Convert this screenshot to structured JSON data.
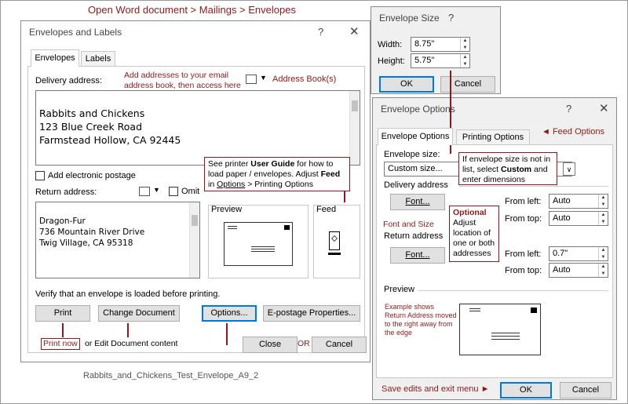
{
  "header_note": "Open Word document  > Mailings > Envelopes",
  "footer_caption": "Rabbits_and_Chickens_Test_Envelope_A9_2",
  "main_dialog": {
    "title": "Envelopes and Labels",
    "help": "?",
    "close": "✕",
    "tab_envelopes": "Envelopes",
    "tab_labels": "Labels",
    "delivery_label": "Delivery address:",
    "delivery_text": "Rabbits and Chickens\n123 Blue Creek Road\nFarmstead Hollow, CA 92445",
    "address_book_label": "Address Book(s)",
    "add_postage_label": "Add electronic postage",
    "return_label": "Return address:",
    "omit_label": "Omit",
    "return_text": "Dragon-Fur\n736 Mountain River Drive\nTwig Village, CA 95318",
    "preview_label": "Preview",
    "feed_label": "Feed",
    "verify_text": "Verify that an envelope is loaded before printing.",
    "print_btn": "Print",
    "change_doc_btn": "Change Document",
    "options_btn": "Options...",
    "epostage_btn": "E-postage Properties...",
    "close_btn": "Close",
    "cancel_btn": "Cancel"
  },
  "annotations": {
    "addresses_note": "Add addresses to your email address book, then access here",
    "printer_note_1": "See printer ",
    "printer_note_user_guide": "User Guide",
    "printer_note_2": " for how to load paper / envelopes.  Adjust ",
    "printer_note_feed": "Feed",
    "printer_note_3": " in ",
    "printer_note_options": "Options",
    "printer_note_4": " > Printing Options",
    "print_now_note": "Print now",
    "edit_doc_note": "or Edit Document content",
    "or_note": "OR",
    "feed_options_note": "Feed Options",
    "size_note_1": "If envelope size is not in list, select ",
    "size_note_custom": "Custom",
    "size_note_2": " and enter dimensions",
    "font_size_note": "Font and Size",
    "optional_note_title": "Optional",
    "optional_note_body": "Adjust location of one or both addresses",
    "example_note": "Example shows Return Address moved to the right away from the edge",
    "save_note": "Save edits and exit menu"
  },
  "size_dialog": {
    "title": "Envelope Size",
    "help": "?",
    "width_label": "Width:",
    "width_value": "8.75\"",
    "height_label": "Height:",
    "height_value": "5.75\"",
    "ok_btn": "OK",
    "cancel_btn": "Cancel"
  },
  "options_dialog": {
    "title": "Envelope Options",
    "help": "?",
    "close": "✕",
    "tab_envelope_options": "Envelope Options",
    "tab_printing_options": "Printing Options",
    "envelope_size_label": "Envelope size:",
    "envelope_size_value": "Custom size...",
    "delivery_section": "Delivery address",
    "font_btn_1": "Font...",
    "from_left_label_1": "From left:",
    "from_left_value_1": "Auto",
    "from_top_label_1": "From top:",
    "from_top_value_1": "Auto",
    "return_section": "Return address",
    "font_btn_2": "Font...",
    "from_left_label_2": "From left:",
    "from_left_value_2": "0.7\"",
    "from_top_label_2": "From top:",
    "from_top_value_2": "Auto",
    "preview_label": "Preview",
    "ok_btn": "OK",
    "cancel_btn": "Cancel"
  },
  "colors": {
    "annotation": "#8b1a1a",
    "accent": "#0078d7"
  }
}
